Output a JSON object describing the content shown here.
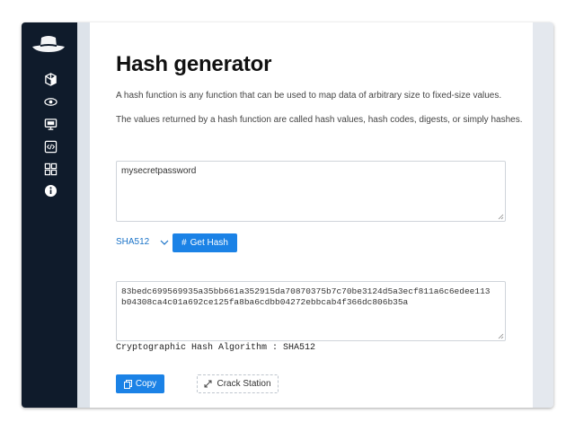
{
  "page": {
    "title": "Hash generator",
    "description_1": "A hash function is any function that can be used to map data of arbitrary size to fixed-size values.",
    "description_2": "The values returned by a hash function are called hash values, hash codes, digests, or simply hashes."
  },
  "sidebar": {
    "logo": "hat-logo",
    "items": [
      {
        "icon": "cube-icon"
      },
      {
        "icon": "eye-icon"
      },
      {
        "icon": "monitor-icon"
      },
      {
        "icon": "code-icon"
      },
      {
        "icon": "grid-icon"
      },
      {
        "icon": "info-icon"
      }
    ]
  },
  "input": {
    "value": "mysecretpassword"
  },
  "algorithm": {
    "selected": "SHA512"
  },
  "buttons": {
    "get_hash": "Get Hash",
    "copy": "Copy",
    "crack_station": "Crack Station"
  },
  "output": {
    "line_1": "83bedc699569935a35bb661a352915da70870375b7c70be3124d5a3ecf811a6c6edee113",
    "line_2": "b04308ca4c01a692ce125fa8ba6cdbb04272ebbcab4f366dc806b35a",
    "algorithm_label": "Cryptographic Hash Algorithm : SHA512"
  },
  "colors": {
    "sidebar": "#0f1b2b",
    "accent": "#1b82e6",
    "link": "#1a73c8"
  }
}
